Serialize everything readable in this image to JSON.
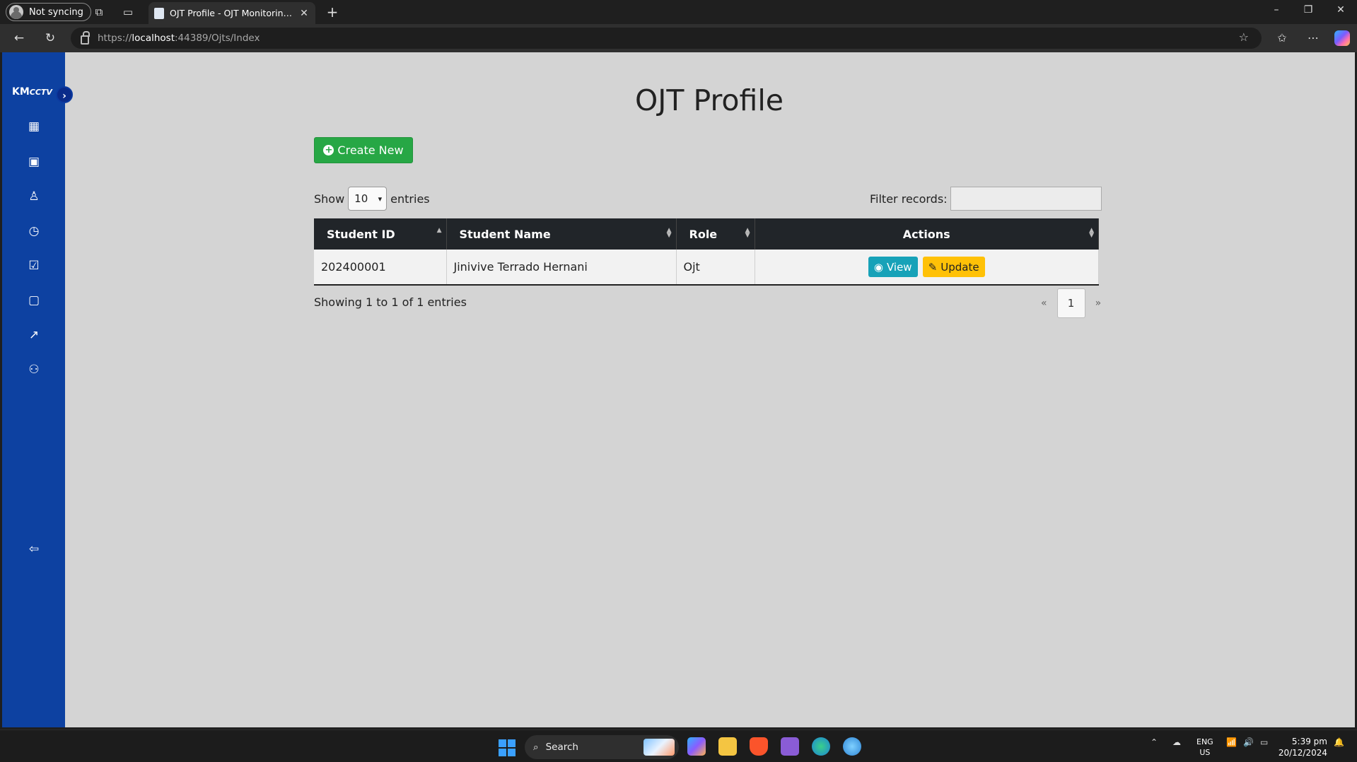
{
  "browser": {
    "profile_label": "Not syncing",
    "tab_title": "OJT Profile - OJT Monitoring System",
    "url_prefix": "https://",
    "url_host": "localhost",
    "url_rest": ":44389/Ojts/Index"
  },
  "app": {
    "logo_km": "KM",
    "logo_cctv": "CCTV",
    "sidebar_icons": [
      "dashboard-icon",
      "id-card-icon",
      "user-icon",
      "clock-icon",
      "calendar-check-icon",
      "clipboard-icon",
      "chart-line-icon",
      "users-icon"
    ],
    "logout_icon": "logout-icon"
  },
  "page": {
    "title": "OJT Profile",
    "create_button": "Create New",
    "show_label": "Show",
    "entries_value": "10",
    "entries_label": "entries",
    "filter_label": "Filter records:",
    "filter_value": ""
  },
  "table": {
    "headers": [
      "Student ID",
      "Student Name",
      "Role",
      "Actions"
    ],
    "rows": [
      {
        "student_id": "202400001",
        "student_name": "Jinivive Terrado Hernani",
        "role": "Ojt",
        "view": "View",
        "update": "Update"
      }
    ],
    "info": "Showing 1 to 1 of 1 entries",
    "prev": "«",
    "page": "1",
    "next": "»"
  },
  "taskbar": {
    "search_placeholder": "Search",
    "lang_top": "ENG",
    "lang_bottom": "US",
    "time": "5:39 pm",
    "date": "20/12/2024"
  },
  "colors": {
    "sidebar": "#0d41a1",
    "create": "#27a745",
    "view": "#17a2b8",
    "update": "#ffc107",
    "table_header": "#212529"
  }
}
